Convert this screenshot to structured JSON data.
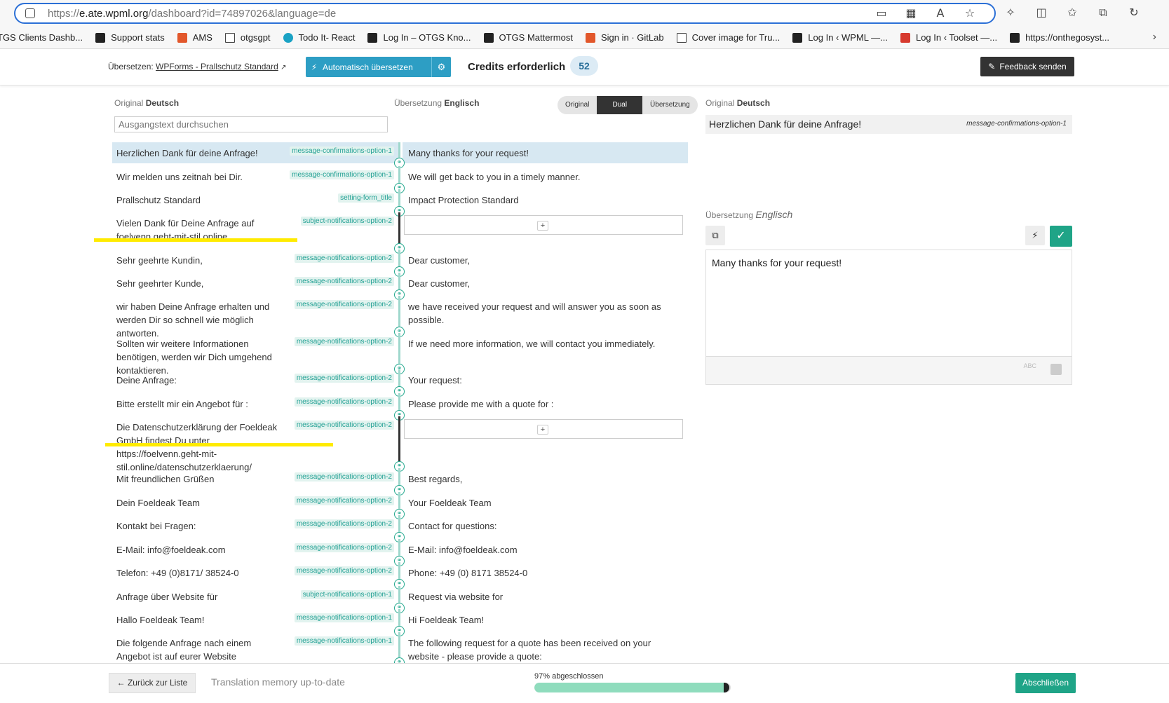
{
  "browser": {
    "url_prefix": "https://",
    "url_host": "e.ate.wpml.org",
    "url_path": "/dashboard?id=74897026&language=de"
  },
  "bookmarks": [
    {
      "label": "TGS Clients Dashb...",
      "icon": "globe-icon"
    },
    {
      "label": "Support stats",
      "icon": "otgs-icon"
    },
    {
      "label": "AMS",
      "icon": "gear-icon"
    },
    {
      "label": "otgsgpt",
      "icon": "doc-icon"
    },
    {
      "label": "Todo It- React",
      "icon": "react-icon"
    },
    {
      "label": "Log In – OTGS Kno...",
      "icon": "power-icon"
    },
    {
      "label": "OTGS Mattermost",
      "icon": "mattermost-icon"
    },
    {
      "label": "Sign in · GitLab",
      "icon": "gitlab-icon"
    },
    {
      "label": "Cover image for Tru...",
      "icon": "doc-icon"
    },
    {
      "label": "Log In ‹ WPML —...",
      "icon": "wpml-icon"
    },
    {
      "label": "Log In ‹ Toolset —...",
      "icon": "toolset-icon"
    },
    {
      "label": "https://onthegosyst...",
      "icon": "otgs-dark-icon"
    }
  ],
  "header": {
    "translate_prefix": "Übersetzen:",
    "job_title": "WPForms - Prallschutz Standard",
    "auto_translate_label": "Automatisch übersetzen",
    "credits_label": "Credits erforderlich",
    "credits_value": "52",
    "feedback_label": "Feedback senden"
  },
  "columns": {
    "original_label": "Original",
    "original_lang": "Deutsch",
    "translation_label": "Übersetzung",
    "translation_lang": "Englisch",
    "search_placeholder": "Ausgangstext durchsuchen"
  },
  "view_toggle": {
    "original": "Original",
    "dual": "Dual",
    "translation": "Übersetzung"
  },
  "rows": [
    {
      "src": "Herzlichen Dank für deine Anfrage!",
      "tag": "message-confirmations-option-1",
      "tgt": "Many thanks for your request!"
    },
    {
      "src": "Wir melden uns zeitnah bei Dir.",
      "tag": "message-confirmations-option-1",
      "tgt": "We will get back to you in a timely manner."
    },
    {
      "src": "Prallschutz Standard",
      "tag": "setting-form_title",
      "tgt": "Impact Protection Standard"
    },
    {
      "src": "Vielen Dank für Deine Anfrage auf foelvenn.geht-mit-stil.online",
      "tag": "subject-notifications-option-2",
      "tgt": ""
    },
    {
      "src": "Sehr geehrte Kundin,",
      "tag": "message-notifications-option-2",
      "tgt": "Dear customer,"
    },
    {
      "src": "Sehr geehrter Kunde,",
      "tag": "message-notifications-option-2",
      "tgt": "Dear customer,"
    },
    {
      "src": "wir haben Deine Anfrage erhalten und werden Dir so schnell wie möglich antworten.",
      "tag": "message-notifications-option-2",
      "tgt": "we have received your request and will answer you as soon as possible."
    },
    {
      "src": "Sollten wir weitere Informationen benötigen, werden wir Dich umgehend kontaktieren.",
      "tag": "message-notifications-option-2",
      "tgt": "If we need more information, we will contact you immediately."
    },
    {
      "src": "Deine Anfrage:",
      "tag": "message-notifications-option-2",
      "tgt": "Your request:"
    },
    {
      "src": "Bitte erstellt mir ein Angebot für :",
      "tag": "message-notifications-option-2",
      "tgt": "Please provide me with a quote for :"
    },
    {
      "src": "Die Datenschutzerklärung der Foeldeak GmbH findest Du unter https://foelvenn.geht-mit-stil.online/datenschutzerklaerung/",
      "tag": "message-notifications-option-2",
      "tgt": ""
    },
    {
      "src": "Mit freundlichen Grüßen",
      "tag": "message-notifications-option-2",
      "tgt": "Best regards,"
    },
    {
      "src": "Dein Foeldeak Team",
      "tag": "message-notifications-option-2",
      "tgt": "Your Foeldeak Team"
    },
    {
      "src": "Kontakt bei Fragen:",
      "tag": "message-notifications-option-2",
      "tgt": "Contact for questions:"
    },
    {
      "src": "E-Mail: info@foeldeak.com",
      "tag": "message-notifications-option-2",
      "tgt": "E-Mail: info@foeldeak.com"
    },
    {
      "src": "Telefon: +49 (0)8171/ 38524-0",
      "tag": "message-notifications-option-2",
      "tgt": "Phone: +49 (0) 8171 38524-0"
    },
    {
      "src": "Anfrage über Website für",
      "tag": "subject-notifications-option-1",
      "tgt": "Request via website for"
    },
    {
      "src": "Hallo Foeldeak Team!",
      "tag": "message-notifications-option-1",
      "tgt": "Hi Foeldeak Team!"
    },
    {
      "src": "Die folgende Anfrage nach einem Angebot ist auf eurer Website eingegangen - bitte ein Angebot",
      "tag": "message-notifications-option-1",
      "tgt": "The following request for a quote has been received on your website - please provide a quote:"
    }
  ],
  "right_panel": {
    "original_label": "Original",
    "original_lang": "Deutsch",
    "original_text": "Herzlichen Dank für deine Anfrage!",
    "original_tag": "message-confirmations-option-1",
    "translation_label": "Übersetzung",
    "translation_lang": "Englisch",
    "translation_text": "Many thanks for your request!",
    "spell_label": "ABC"
  },
  "footer": {
    "back_label": "← Zurück zur Liste",
    "tm_status": "Translation memory up-to-date",
    "progress_label": "97% abgeschlossen",
    "progress_fraction": 0.97,
    "finish_label": "Abschließen"
  },
  "colors": {
    "accent_blue": "#2d9ec4",
    "accent_green": "#1fa487",
    "highlight": "#ffeb00"
  }
}
